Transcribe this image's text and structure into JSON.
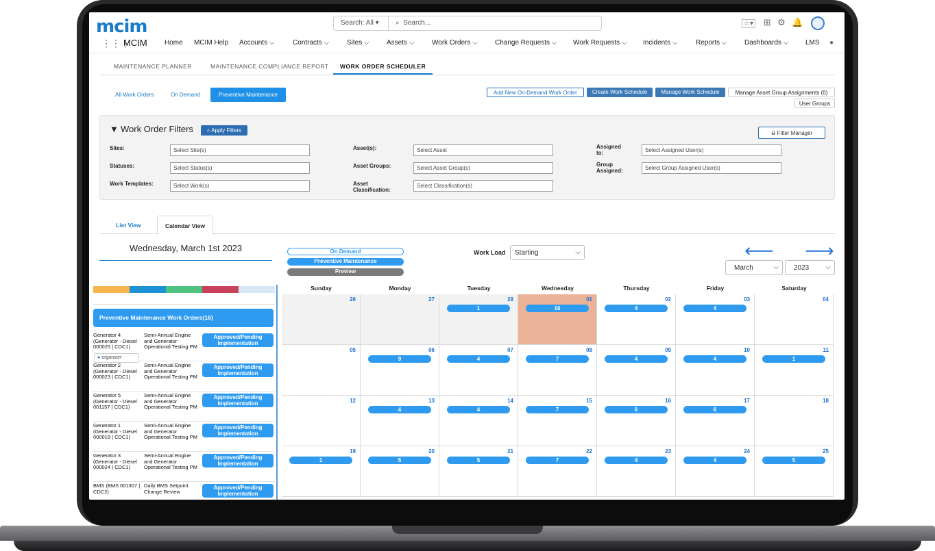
{
  "header": {
    "logo": "mcim",
    "app_name": "MCIM",
    "search_scope": "Search: All",
    "search_placeholder": "Search...",
    "nav": [
      "Home",
      "MCIM Help",
      "Accounts",
      "Contracts",
      "Sites",
      "Assets",
      "Work Orders",
      "Change Requests",
      "Work Requests",
      "Incidents",
      "Reports",
      "Dashboards",
      "LMS"
    ]
  },
  "subtabs": [
    "MAINTENANCE PLANNER",
    "MAINTENANCE COMPLIANCE REPORT",
    "WORK ORDER SCHEDULER"
  ],
  "filter_tabs": {
    "all": "All Work Orders",
    "ondemand": "On Demand",
    "preventive": "Preventive Maintenance"
  },
  "actions": {
    "add_new": "Add New On-Demand Work Order",
    "create": "Create Work Schedule",
    "manage": "Manage Work Schedule",
    "asset_groups": "Manage Asset Group Assignments (0)",
    "user_groups": "User Groups"
  },
  "filters": {
    "title": "Work Order Filters",
    "apply": "Apply Filters",
    "manager": "Filter Manager",
    "labels": {
      "sites": "Sites:",
      "statuses": "Statuses:",
      "work_templates": "Work Templates:",
      "assets": "Asset(s):",
      "asset_groups": "Asset Groups:",
      "asset_class_1": "Asset",
      "asset_class_2": "Classification:",
      "assigned_1": "Assigned",
      "assigned_2": "to:",
      "group_1": "Group",
      "group_2": "Assigned:"
    },
    "placeholders": {
      "sites": "Select Site(s)",
      "statuses": "Select Status(s)",
      "work": "Select Work(s)",
      "asset": "Select Asset",
      "asset_group": "Select Asset Group(s)",
      "classification": "Select Classification(s)",
      "assigned": "Select Assigned User(s)",
      "group_assigned": "Select Group Assigned User(s)"
    }
  },
  "views": {
    "list": "List View",
    "calendar": "Calendar View"
  },
  "date_title": "Wednesday, March 1st 2023",
  "legend": {
    "ondemand": "On Demand",
    "preventive": "Preventive Maintenance",
    "preview": "Preview"
  },
  "workload": {
    "label": "Work Load",
    "value": "Starting"
  },
  "month_select": "March",
  "year_select": "2023",
  "colors": {
    "accent": "#2e9bf0",
    "link": "#1a7bc9",
    "today": "#eab398",
    "preview": "#7a7a7a"
  },
  "legend_colors": [
    "#f6b54f",
    "#1e90d6",
    "#4fc27f",
    "#c9425b",
    "#d7e8f7"
  ],
  "left_panel": {
    "header": "Preventive Maintenance Work Orders(16)",
    "organizer": "organizer",
    "rows": [
      {
        "asset": "Generator 4 (Generator - Diesel 000025 | CDC1)",
        "task": "Semi-Annual Engine and Generator Operational Testing PM",
        "status": "Approved/Pending Implementation"
      },
      {
        "asset": "Generator 2 (Generator - Diesel 000023 | CDC1)",
        "task": "Semi-Annual Engine and Generator Operational Testing PM",
        "status": "Approved/Pending Implementation"
      },
      {
        "asset": "Generator 5 (Generator - Diesel 001157 | CDC1)",
        "task": "Semi-Annual Engine and Generator Operational Testing PM",
        "status": "Approved/Pending Implementation"
      },
      {
        "asset": "Generator 1 (Generator - Diesel 000019 | CDC1)",
        "task": "Semi-Annual Engine and Generator Operational Testing PM",
        "status": "Approved/Pending Implementation"
      },
      {
        "asset": "Generator 3 (Generator - Diesel 000024 | CDC1)",
        "task": "Semi-Annual Engine and Generator Operational Testing PM",
        "status": "Approved/Pending Implementation"
      },
      {
        "asset": "BMS (BMS 001307 | CDC2)",
        "task": "Daily BMS Setpoint Change Review",
        "status": "Approved/Pending Implementation"
      }
    ]
  },
  "calendar": {
    "weekdays": [
      "Sunday",
      "Monday",
      "Tuesday",
      "Wednesday",
      "Thursday",
      "Friday",
      "Saturday"
    ],
    "weeks": [
      [
        {
          "day": "26",
          "count": "",
          "other": true
        },
        {
          "day": "27",
          "count": "",
          "other": true
        },
        {
          "day": "28",
          "count": "1",
          "other": true
        },
        {
          "day": "01",
          "count": "16",
          "today": true
        },
        {
          "day": "02",
          "count": "4"
        },
        {
          "day": "03",
          "count": "4"
        },
        {
          "day": "04",
          "count": ""
        }
      ],
      [
        {
          "day": "05",
          "count": ""
        },
        {
          "day": "06",
          "count": "9"
        },
        {
          "day": "07",
          "count": "4"
        },
        {
          "day": "08",
          "count": "7"
        },
        {
          "day": "09",
          "count": "4"
        },
        {
          "day": "10",
          "count": "4"
        },
        {
          "day": "11",
          "count": "1"
        }
      ],
      [
        {
          "day": "12",
          "count": ""
        },
        {
          "day": "13",
          "count": "4"
        },
        {
          "day": "14",
          "count": "4"
        },
        {
          "day": "15",
          "count": "7"
        },
        {
          "day": "16",
          "count": "6"
        },
        {
          "day": "17",
          "count": "6"
        },
        {
          "day": "18",
          "count": ""
        }
      ],
      [
        {
          "day": "19",
          "count": "1"
        },
        {
          "day": "20",
          "count": "5"
        },
        {
          "day": "21",
          "count": "5"
        },
        {
          "day": "22",
          "count": "7"
        },
        {
          "day": "23",
          "count": "4"
        },
        {
          "day": "24",
          "count": "4"
        },
        {
          "day": "25",
          "count": "5"
        }
      ]
    ]
  }
}
